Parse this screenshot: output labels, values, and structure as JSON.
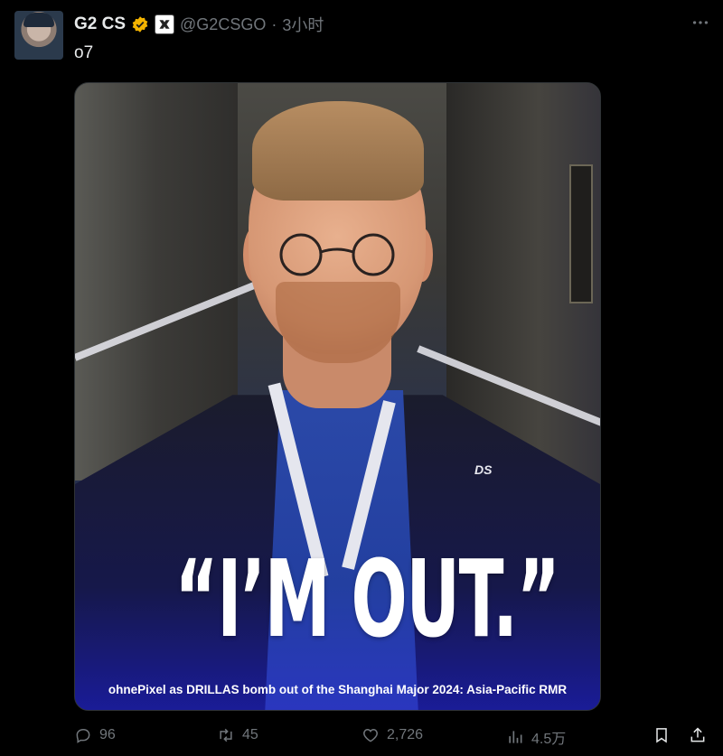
{
  "tweet": {
    "author_name": "G2 CS",
    "handle": "@G2CSGO",
    "separator": "·",
    "time": "3小时",
    "text": "o7",
    "verified_color": "#f4b400"
  },
  "media": {
    "headline": "“I’M OUT.”",
    "caption": "ohnePixel as DRILLAS bomb out of the Shanghai Major 2024: Asia-Pacific RMR",
    "shirt_logo": "DS",
    "accent_color": "#1d1fa5"
  },
  "actions": {
    "replies": "96",
    "retweets": "45",
    "likes": "2,726",
    "views": "4.5万"
  },
  "icons": {
    "more": "more-dots-icon",
    "reply": "reply-icon",
    "retweet": "retweet-icon",
    "like": "heart-icon",
    "views": "views-bar-chart-icon",
    "bookmark": "bookmark-icon",
    "share": "share-icon"
  }
}
